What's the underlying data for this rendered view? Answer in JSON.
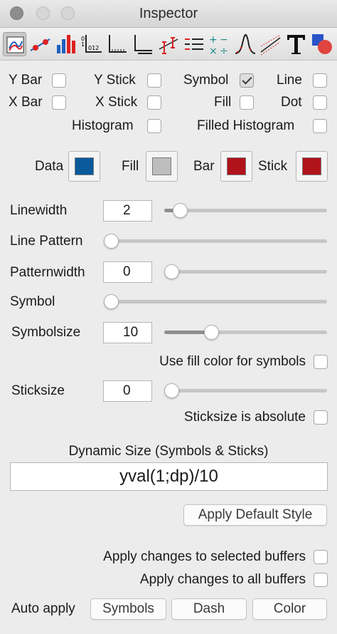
{
  "window": {
    "title": "Inspector"
  },
  "toolbar": {
    "icons": [
      "chart-style-icon",
      "line-symbol-icon",
      "bar-style-icon",
      "axis-ticks-icon",
      "axis-frame-icon",
      "axis-lines-icon",
      "error-bar-icon",
      "legend-icon",
      "math-operators-icon",
      "curve-fit-icon",
      "regression-line-icon",
      "text-icon",
      "shapes-icon"
    ]
  },
  "style_checks": {
    "y_bar": {
      "label": "Y Bar",
      "checked": false
    },
    "y_stick": {
      "label": "Y Stick",
      "checked": false
    },
    "symbol": {
      "label": "Symbol",
      "checked": true
    },
    "line": {
      "label": "Line",
      "checked": false
    },
    "x_bar": {
      "label": "X Bar",
      "checked": false
    },
    "x_stick": {
      "label": "X Stick",
      "checked": false
    },
    "fill": {
      "label": "Fill",
      "checked": false
    },
    "dot": {
      "label": "Dot",
      "checked": false
    },
    "histogram": {
      "label": "Histogram",
      "checked": false
    },
    "filled_histogram": {
      "label": "Filled Histogram",
      "checked": false
    }
  },
  "colors": {
    "data": {
      "label": "Data",
      "color": "#0a5a9c"
    },
    "fill": {
      "label": "Fill",
      "color": "#bdbdbd"
    },
    "bar": {
      "label": "Bar",
      "color": "#b1131b"
    },
    "stick": {
      "label": "Stick",
      "color": "#b1131b"
    }
  },
  "params": {
    "linewidth": {
      "label": "Linewidth",
      "value": "2",
      "slider": 0.06
    },
    "line_pattern": {
      "label": "Line Pattern",
      "slider": 0.0
    },
    "patternwidth": {
      "label": "Patternwidth",
      "value": "0",
      "slider": 0.0
    },
    "symbol": {
      "label": "Symbol",
      "slider": 0.0
    },
    "symbolsize": {
      "label": "Symbolsize",
      "value": "10",
      "slider": 0.27
    },
    "use_fill_color": {
      "label": "Use fill color for symbols",
      "checked": false
    },
    "sticksize": {
      "label": "Sticksize",
      "value": "0",
      "slider": 0.0
    },
    "sticksize_absolute": {
      "label": "Sticksize is absolute",
      "checked": false
    }
  },
  "dynamic_size": {
    "label": "Dynamic Size  (Symbols & Sticks)",
    "value": "yval(1;dp)/10"
  },
  "apply_default_label": "Apply Default Style",
  "apply_selected": {
    "label": "Apply changes to selected buffers",
    "checked": false
  },
  "apply_all": {
    "label": "Apply changes to all buffers",
    "checked": false
  },
  "auto_apply": {
    "label": "Auto apply",
    "buttons": {
      "symbols": "Symbols",
      "dash": "Dash",
      "color": "Color"
    }
  }
}
